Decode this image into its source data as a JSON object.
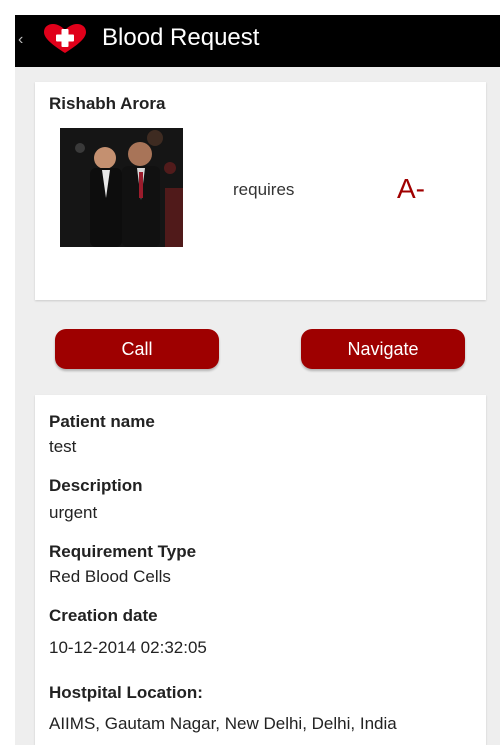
{
  "action_bar": {
    "title": "Blood Request",
    "back_glyph": "‹",
    "logo_icon": "red-heart-cross-icon",
    "brand_color": "#e0001a"
  },
  "requester": {
    "name": "Rishabh Arora",
    "requires_label": "requires",
    "blood_group": "A-",
    "blood_group_color": "#a00000"
  },
  "actions": {
    "call_label": "Call",
    "navigate_label": "Navigate",
    "button_color": "#9e0000"
  },
  "details": {
    "patient_name_label": "Patient name",
    "patient_name_value": "test",
    "description_label": "Description",
    "description_value": "urgent",
    "requirement_type_label": "Requirement Type",
    "requirement_type_value": "Red Blood Cells",
    "creation_date_label": "Creation date",
    "creation_date_value": "10-12-2014 02:32:05",
    "location_label": "Hostpital Location:",
    "location_value": "AIIMS, Gautam Nagar, New Delhi, Delhi, India"
  }
}
